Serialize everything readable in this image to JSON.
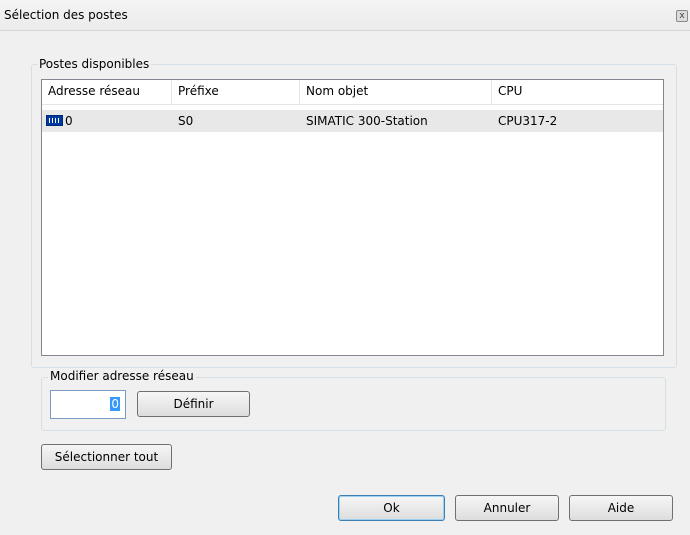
{
  "window": {
    "title": "Sélection des postes",
    "close_symbol": "x"
  },
  "stations_group": {
    "label": "Postes disponibles",
    "columns": [
      "Adresse réseau",
      "Préfixe",
      "Nom objet",
      "CPU"
    ],
    "rows": [
      {
        "address": "0",
        "prefix": "S0",
        "object_name": "SIMATIC 300-Station",
        "cpu": "CPU317-2",
        "icon": "station-rack-icon"
      }
    ]
  },
  "address_group": {
    "label": "Modifier adresse réseau",
    "address_value": "0",
    "define_label": "Définir"
  },
  "select_all_label": "Sélectionner tout",
  "footer": {
    "ok_label": "Ok",
    "cancel_label": "Annuler",
    "help_label": "Aide"
  }
}
